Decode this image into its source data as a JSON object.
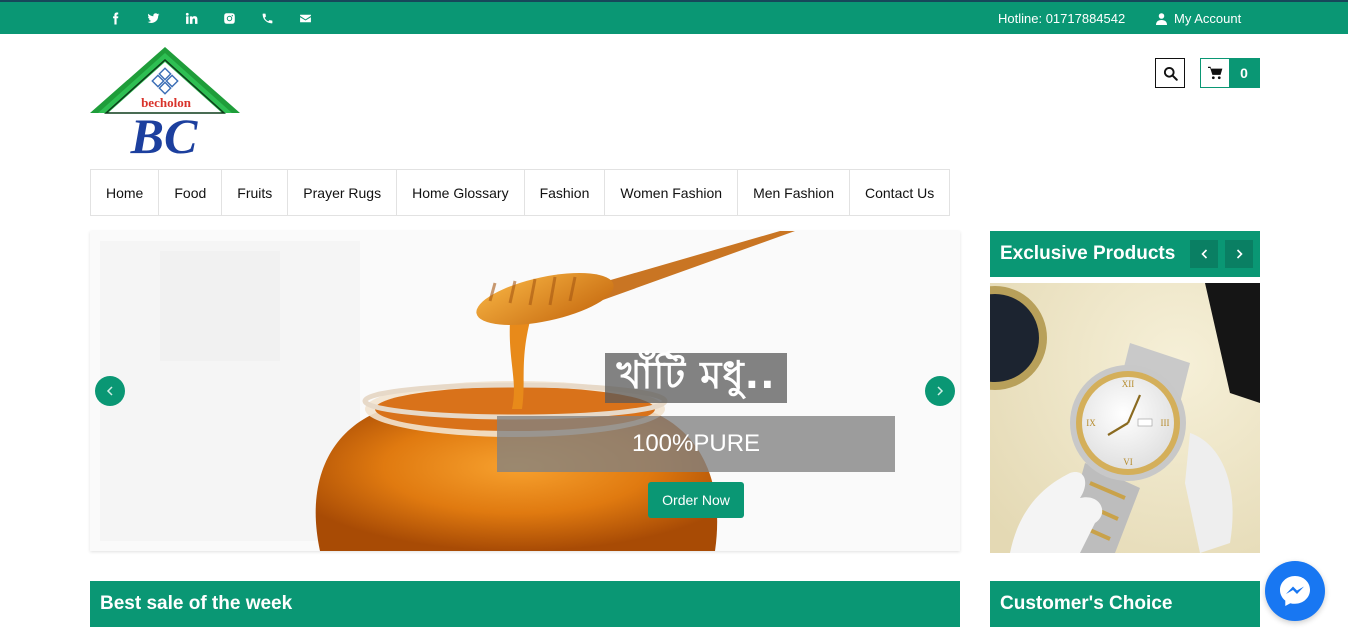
{
  "topbar": {
    "social_icons": [
      "facebook-icon",
      "twitter-icon",
      "linkedin-icon",
      "instagram-icon",
      "phone-icon",
      "envelope-icon"
    ],
    "hotline": "Hotline: 01717884542",
    "account_label": "My Account"
  },
  "brand": {
    "logo_text": "becholon",
    "logo_monogram": "BC"
  },
  "header": {
    "cart_count": "0"
  },
  "nav": {
    "items": [
      "Home",
      "Food",
      "Fruits",
      "Prayer Rugs",
      "Home Glossary",
      "Fashion",
      "Women Fashion",
      "Men Fashion",
      "Contact Us"
    ]
  },
  "slider": {
    "title": "খাঁটি মধু..",
    "subtitle": "100%PURE",
    "button_label": "Order Now"
  },
  "exclusive": {
    "title": "Exclusive Products"
  },
  "sections": {
    "best_sale": "Best sale of the week",
    "customers_choice": "Customer's Choice"
  },
  "colors": {
    "brand_green": "#0a9774",
    "messenger_blue": "#1877f2"
  }
}
